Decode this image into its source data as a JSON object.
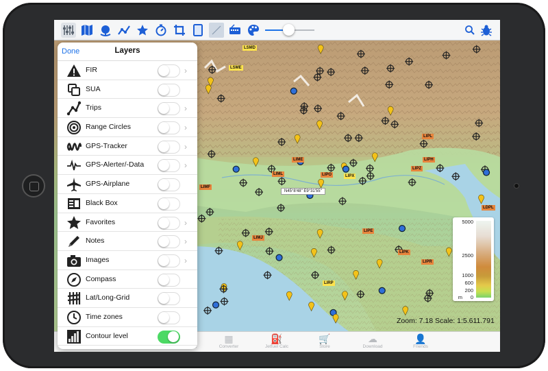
{
  "toolbar": {
    "icons": [
      "layers-settings-icon",
      "map-icon",
      "globe-icon",
      "route-icon",
      "star-icon",
      "timer-icon",
      "crop-icon",
      "tablet-icon",
      "compass-needle-icon",
      "radio-icon",
      "palette-icon",
      "search-icon",
      "bug-icon"
    ],
    "slider_level": 0.47,
    "accent": "#1d5fd6"
  },
  "panel": {
    "done_label": "Done",
    "title": "Layers",
    "rows": [
      {
        "label": "FIR",
        "icon": "warning-icon",
        "on": false,
        "chevron": true
      },
      {
        "label": "SUA",
        "icon": "squares-icon",
        "on": false,
        "chevron": false
      },
      {
        "label": "Trips",
        "icon": "trips-icon",
        "on": false,
        "chevron": true
      },
      {
        "label": "Range Circles",
        "icon": "range-circles-icon",
        "on": false,
        "chevron": true
      },
      {
        "label": "GPS-Tracker",
        "icon": "gps-tracker-icon",
        "on": false,
        "chevron": true
      },
      {
        "label": "GPS-Alerter/-Data",
        "icon": "gps-alerter-icon",
        "on": false,
        "chevron": true
      },
      {
        "label": "GPS-Airplane",
        "icon": "airplane-icon",
        "on": false,
        "chevron": false
      },
      {
        "label": "Black Box",
        "icon": "black-box-icon",
        "on": false,
        "chevron": false
      },
      {
        "label": "Favorites",
        "icon": "star-icon",
        "on": false,
        "chevron": true
      },
      {
        "label": "Notes",
        "icon": "pencil-icon",
        "on": false,
        "chevron": true
      },
      {
        "label": "Images",
        "icon": "camera-icon",
        "on": false,
        "chevron": true
      },
      {
        "label": "Compass",
        "icon": "compass-icon",
        "on": false,
        "chevron": false
      },
      {
        "label": "Lat/Long-Grid",
        "icon": "grid-icon",
        "on": false,
        "chevron": false
      },
      {
        "label": "Time zones",
        "icon": "clock-icon",
        "on": false,
        "chevron": false
      },
      {
        "label": "Contour level",
        "icon": "contour-icon",
        "on": true,
        "chevron": false
      }
    ]
  },
  "map": {
    "zoom_text": "Zoom: 7.18  Scale: 1:5.611.791",
    "coordinate": "N45°8'48\"   E9°31'55\"",
    "legend": {
      "values": [
        "5000",
        "2500",
        "1000",
        "600",
        "200",
        "0"
      ],
      "unit": "m"
    },
    "labels": [
      {
        "t": "LSMD",
        "c": "y"
      },
      {
        "t": "LSME",
        "c": "y"
      },
      {
        "t": "LIPL",
        "c": "o"
      },
      {
        "t": "LIPZ",
        "c": "o"
      },
      {
        "t": "LIPH",
        "c": "o"
      },
      {
        "t": "LIPO",
        "c": "o"
      },
      {
        "t": "LIPX",
        "c": "y"
      },
      {
        "t": "LIML",
        "c": "o"
      },
      {
        "t": "LIME",
        "c": "o"
      },
      {
        "t": "LIMF",
        "c": "o"
      },
      {
        "t": "LIMJ",
        "c": "o"
      },
      {
        "t": "LIPE",
        "c": "o"
      },
      {
        "t": "LIPK",
        "c": "o"
      },
      {
        "t": "LIPR",
        "c": "o"
      },
      {
        "t": "LIRP",
        "c": "y"
      },
      {
        "t": "LDPL",
        "c": "o"
      }
    ]
  },
  "tabbar": {
    "items": [
      {
        "label": "Map",
        "icon": "map-tab-icon"
      },
      {
        "label": "Captains Corner",
        "icon": "captain-icon"
      },
      {
        "label": "Converter",
        "icon": "calculator-icon"
      },
      {
        "label": "Jetfuel Calc",
        "icon": "fuel-icon"
      },
      {
        "label": "Store",
        "icon": "cart-icon"
      },
      {
        "label": "Download",
        "icon": "cloud-download-icon"
      },
      {
        "label": "Friends",
        "icon": "friends-icon"
      }
    ]
  }
}
